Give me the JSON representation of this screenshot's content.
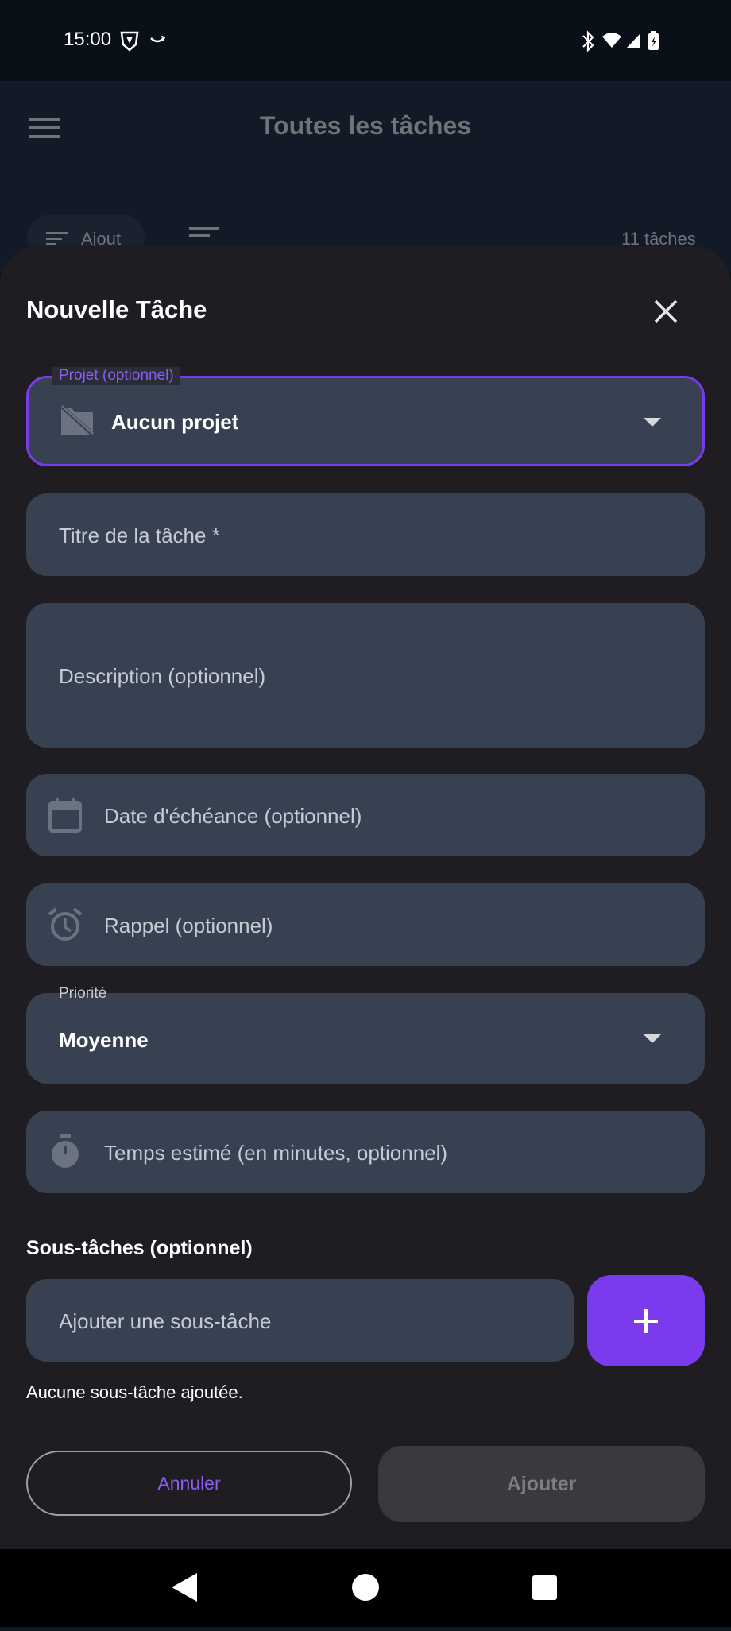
{
  "status_bar": {
    "time": "15:00"
  },
  "app": {
    "title": "Toutes les tâches",
    "chip_label": "Ajout",
    "task_count": "11 tâches"
  },
  "sheet": {
    "title": "Nouvelle Tâche",
    "project": {
      "label": "Projet (optionnel)",
      "value": "Aucun projet"
    },
    "title_field": {
      "placeholder": "Titre de la tâche *"
    },
    "description_field": {
      "placeholder": "Description (optionnel)"
    },
    "due_date_field": {
      "placeholder": "Date d'échéance (optionnel)"
    },
    "reminder_field": {
      "placeholder": "Rappel (optionnel)"
    },
    "priority": {
      "label": "Priorité",
      "value": "Moyenne"
    },
    "estimate_field": {
      "placeholder": "Temps estimé (en minutes, optionnel)"
    },
    "subtasks": {
      "title": "Sous-tâches (optionnel)",
      "input_placeholder": "Ajouter une sous-tâche",
      "empty_message": "Aucune sous-tâche ajoutée."
    },
    "actions": {
      "cancel": "Annuler",
      "submit": "Ajouter"
    }
  },
  "colors": {
    "accent": "#7c3aed",
    "field_bg": "#374151",
    "sheet_bg": "#1f1d22"
  }
}
